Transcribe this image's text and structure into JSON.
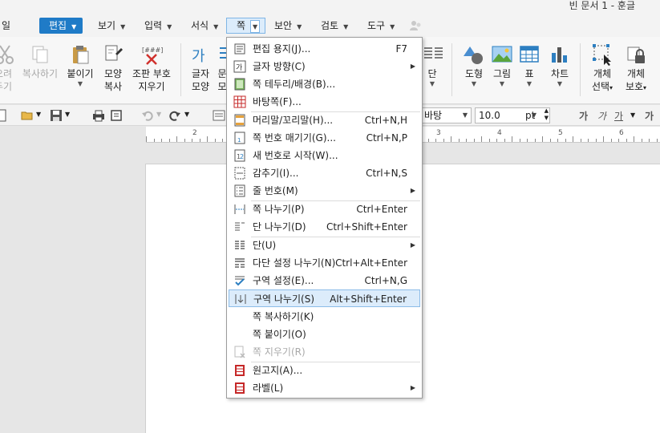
{
  "window": {
    "title": "빈 문서 1 - 훈글"
  },
  "menubar": {
    "file": "일",
    "items": [
      {
        "label": "편집",
        "state": "primary"
      },
      {
        "label": "보기"
      },
      {
        "label": "입력"
      },
      {
        "label": "서식"
      },
      {
        "label": "쪽",
        "state": "open"
      },
      {
        "label": "보안"
      },
      {
        "label": "검토"
      },
      {
        "label": "도구"
      }
    ]
  },
  "ribbon": {
    "cut": [
      "오려",
      "두기"
    ],
    "copy": "복사하기",
    "paste": "붙이기",
    "format_copy": [
      "모양",
      "복사"
    ],
    "clear": [
      "조판 부호",
      "지우기"
    ],
    "char_shape": [
      "글자",
      "모양"
    ],
    "para_shape": [
      "문",
      "모"
    ],
    "column": "단",
    "shape": "도형",
    "picture": "그림",
    "table": "표",
    "chart": "차트",
    "obj_select": [
      "개체",
      "선택"
    ],
    "obj_protect": [
      "개체",
      "보호"
    ]
  },
  "toolbar2": {
    "font_name": "바탕",
    "font_size": "10.0",
    "size_unit": "pt",
    "bold": "가",
    "italic": "가",
    "underline": "가",
    "more": "가"
  },
  "ruler": {
    "numbers": [
      "2",
      "3",
      "4",
      "5",
      "6"
    ]
  },
  "dropdown": {
    "items": [
      {
        "label": "편집 용지(J)...",
        "shortcut": "F7",
        "icon": "page-setup-icon"
      },
      {
        "label": "글자 방향(C)",
        "submenu": true,
        "icon": "text-direction-icon"
      },
      {
        "label": "쪽 테두리/배경(B)...",
        "icon": "page-border-icon"
      },
      {
        "label": "바탕쪽(F)...",
        "icon": "master-page-icon"
      },
      {
        "label": "머리말/꼬리말(H)...",
        "shortcut": "Ctrl+N,H",
        "icon": "header-footer-icon"
      },
      {
        "label": "쪽 번호 매기기(G)...",
        "shortcut": "Ctrl+N,P",
        "icon": "page-number-icon"
      },
      {
        "label": "새 번호로 시작(W)...",
        "icon": "new-number-icon"
      },
      {
        "label": "감추기(I)...",
        "shortcut": "Ctrl+N,S",
        "icon": "hide-icon"
      },
      {
        "label": "줄 번호(M)",
        "submenu": true,
        "icon": "line-number-icon"
      },
      {
        "label": "쪽 나누기(P)",
        "shortcut": "Ctrl+Enter",
        "icon": "page-break-icon"
      },
      {
        "label": "단 나누기(D)",
        "shortcut": "Ctrl+Shift+Enter",
        "icon": "column-break-icon"
      },
      {
        "label": "단(U)",
        "submenu": true,
        "icon": "columns-icon"
      },
      {
        "label": "다단 설정 나누기(N)",
        "shortcut": "Ctrl+Alt+Enter",
        "icon": "multi-column-break-icon"
      },
      {
        "label": "구역 설정(E)...",
        "shortcut": "Ctrl+N,G",
        "icon": "section-setup-icon"
      },
      {
        "label": "구역 나누기(S)",
        "shortcut": "Alt+Shift+Enter",
        "icon": "section-break-icon",
        "highlight": true
      },
      {
        "label": "쪽 복사하기(K)"
      },
      {
        "label": "쪽 붙이기(O)"
      },
      {
        "label": "쪽 지우기(R)",
        "disabled": true,
        "icon": "delete-page-icon"
      },
      {
        "label": "원고지(A)...",
        "icon": "manuscript-icon"
      },
      {
        "label": "라벨(L)",
        "submenu": true,
        "icon": "label-icon"
      }
    ]
  },
  "colors": {
    "accent": "#1f7bc7",
    "highlight": "#dcecfb",
    "red_icon": "#c62828"
  }
}
